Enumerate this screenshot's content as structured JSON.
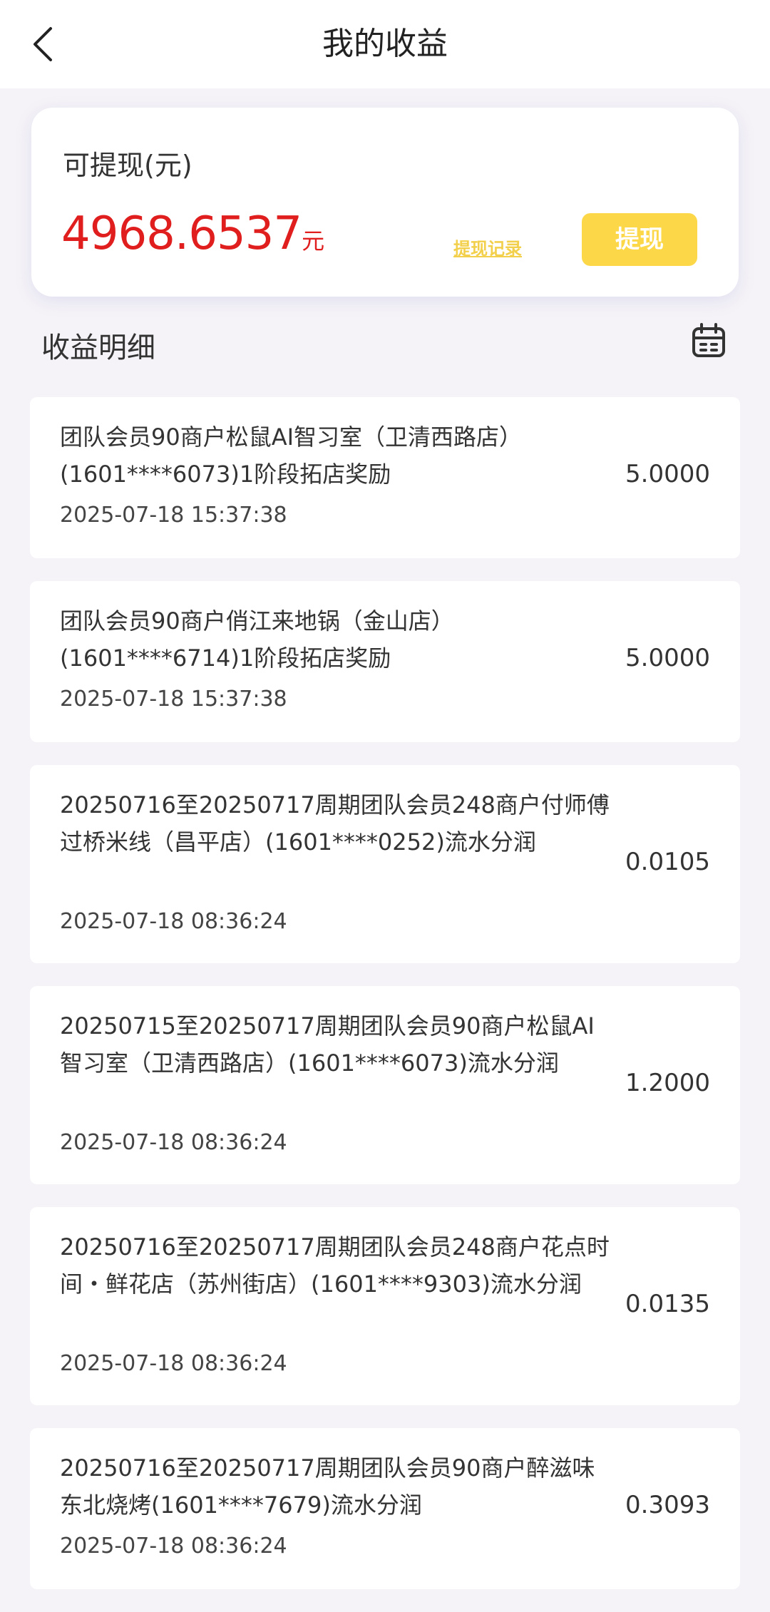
{
  "header": {
    "title": "我的收益",
    "back_icon": "chevron-left-icon"
  },
  "balance": {
    "label": "可提现(元)",
    "amount": "4968.6537",
    "unit": "元",
    "record_link": "提现记录",
    "withdraw_button": "提现"
  },
  "colors": {
    "amount_red": "#e01e1e",
    "accent_yellow": "#fcd849",
    "page_bg": "#f5f3f7"
  },
  "section": {
    "title": "收益明细",
    "calendar_icon": "calendar-icon"
  },
  "items": [
    {
      "desc": "团队会员90商户松鼠AI智习室（卫清西路店）(1601****6073)1阶段拓店奖励",
      "time": "2025-07-18 15:37:38",
      "amount": "5.0000"
    },
    {
      "desc": "团队会员90商户俏江来地锅（金山店）(1601****6714)1阶段拓店奖励",
      "time": "2025-07-18 15:37:38",
      "amount": "5.0000"
    },
    {
      "desc": "20250716至20250717周期团队会员248商户付师傅过桥米线（昌平店）(1601****0252)流水分润",
      "time": "2025-07-18 08:36:24",
      "amount": "0.0105"
    },
    {
      "desc": "20250715至20250717周期团队会员90商户松鼠AI智习室（卫清西路店）(1601****6073)流水分润",
      "time": "2025-07-18 08:36:24",
      "amount": "1.2000"
    },
    {
      "desc": "20250716至20250717周期团队会员248商户花点时间・鲜花店（苏州街店）(1601****9303)流水分润",
      "time": "2025-07-18 08:36:24",
      "amount": "0.0135"
    },
    {
      "desc": "20250716至20250717周期团队会员90商户醉滋味东北烧烤(1601****7679)流水分润",
      "time": "2025-07-18 08:36:24",
      "amount": "0.3093"
    }
  ]
}
